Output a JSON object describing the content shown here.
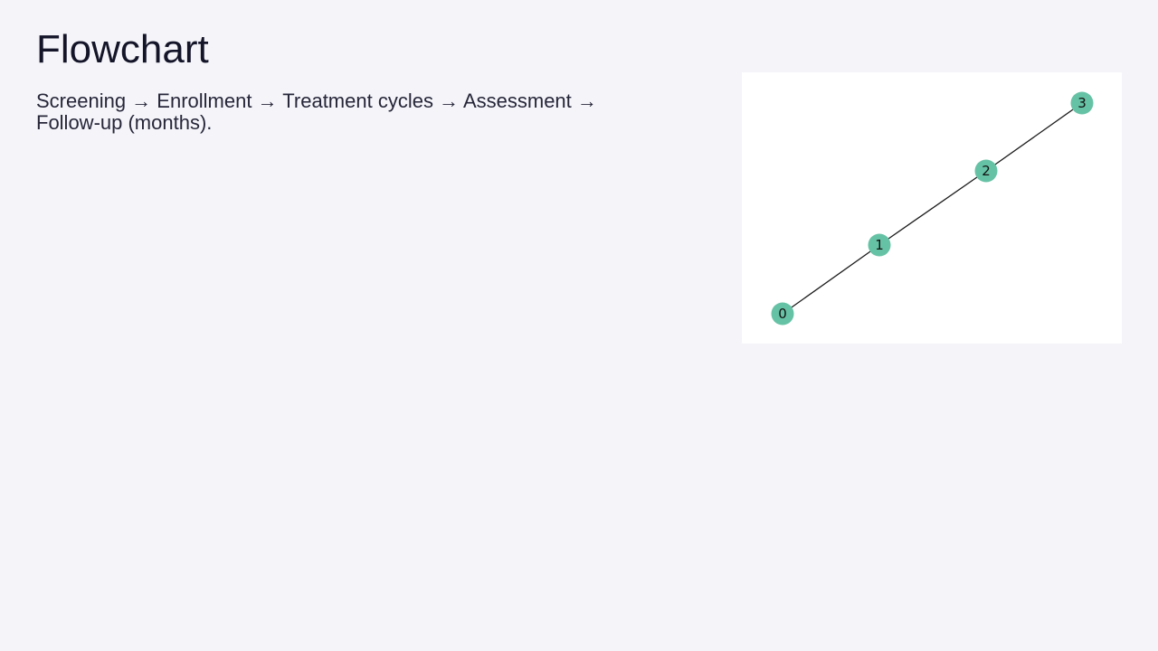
{
  "header": {
    "title": "Flowchart"
  },
  "main": {
    "description": "Screening → Enrollment → Treatment cycles → Assessment → Follow-up (months)."
  },
  "diagram": {
    "node_color": "#66c2a5",
    "edge_color": "#1a1a1a",
    "nodes": [
      {
        "label": "0"
      },
      {
        "label": "1"
      },
      {
        "label": "2"
      },
      {
        "label": "3"
      }
    ],
    "edges": [
      [
        "0",
        "1"
      ],
      [
        "1",
        "2"
      ],
      [
        "2",
        "3"
      ]
    ]
  }
}
